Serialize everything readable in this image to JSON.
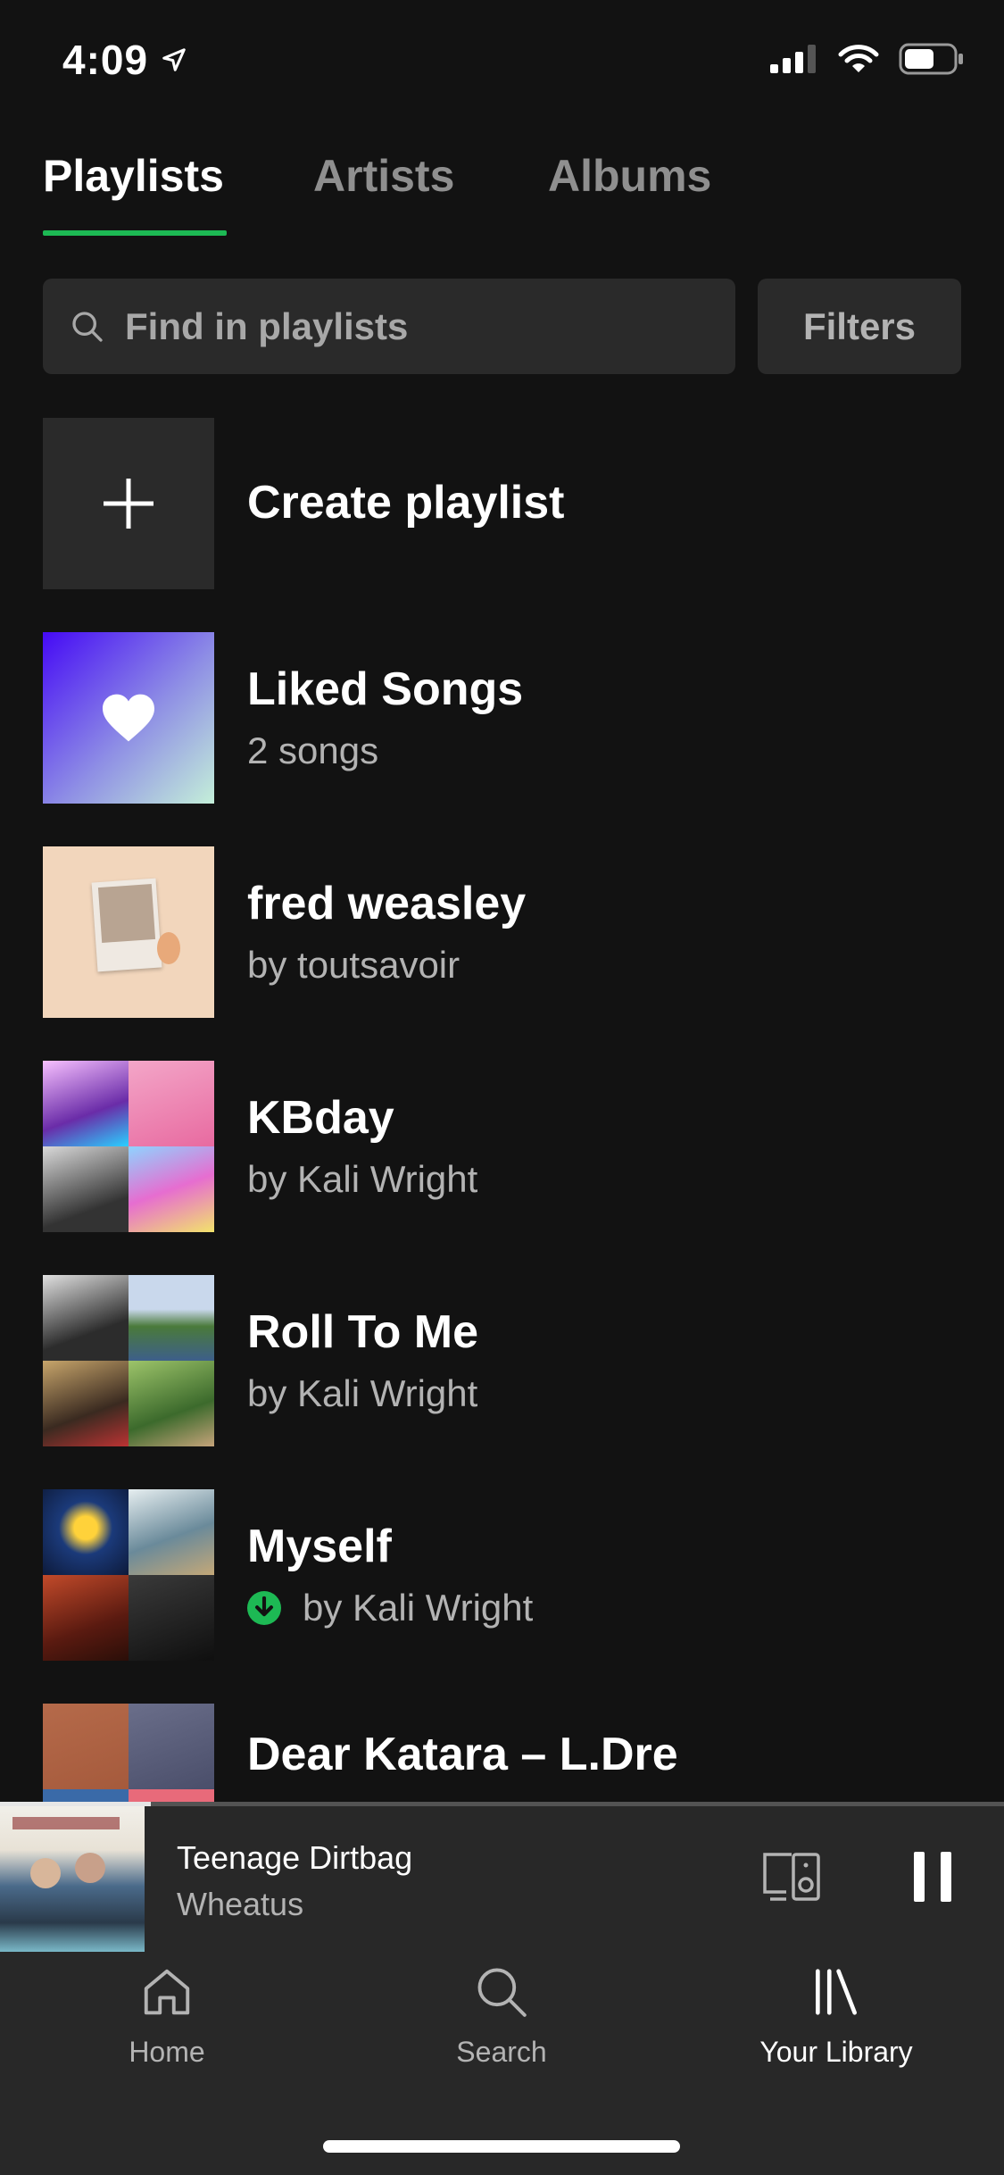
{
  "status_bar": {
    "time": "4:09"
  },
  "tabs": [
    {
      "label": "Playlists",
      "active": true
    },
    {
      "label": "Artists",
      "active": false
    },
    {
      "label": "Albums",
      "active": false
    }
  ],
  "search": {
    "placeholder": "Find in playlists"
  },
  "filters_label": "Filters",
  "create_playlist_label": "Create playlist",
  "playlists": [
    {
      "title": "Liked Songs",
      "subtitle": "2 songs",
      "art": "heart-gradient"
    },
    {
      "title": "fred weasley",
      "subtitle": "by toutsavoir",
      "art": "single-cover"
    },
    {
      "title": "KBday",
      "subtitle": "by Kali Wright",
      "art": "mosaic"
    },
    {
      "title": "Roll To Me",
      "subtitle": "by Kali Wright",
      "art": "mosaic"
    },
    {
      "title": "Myself",
      "subtitle": "by Kali Wright",
      "art": "mosaic",
      "downloaded": true
    },
    {
      "title": "Dear Katara – L.Dre",
      "subtitle": "",
      "art": "mosaic"
    }
  ],
  "now_playing": {
    "track": "Teenage Dirtbag",
    "artist": "Wheatus",
    "progress": 0.15
  },
  "bottom_nav": [
    {
      "label": "Home",
      "icon": "home-icon",
      "active": false
    },
    {
      "label": "Search",
      "icon": "search-icon",
      "active": false
    },
    {
      "label": "Your Library",
      "icon": "library-icon",
      "active": true
    }
  ],
  "colors": {
    "accent": "#1db954",
    "background": "#121212",
    "surface": "#282828"
  }
}
